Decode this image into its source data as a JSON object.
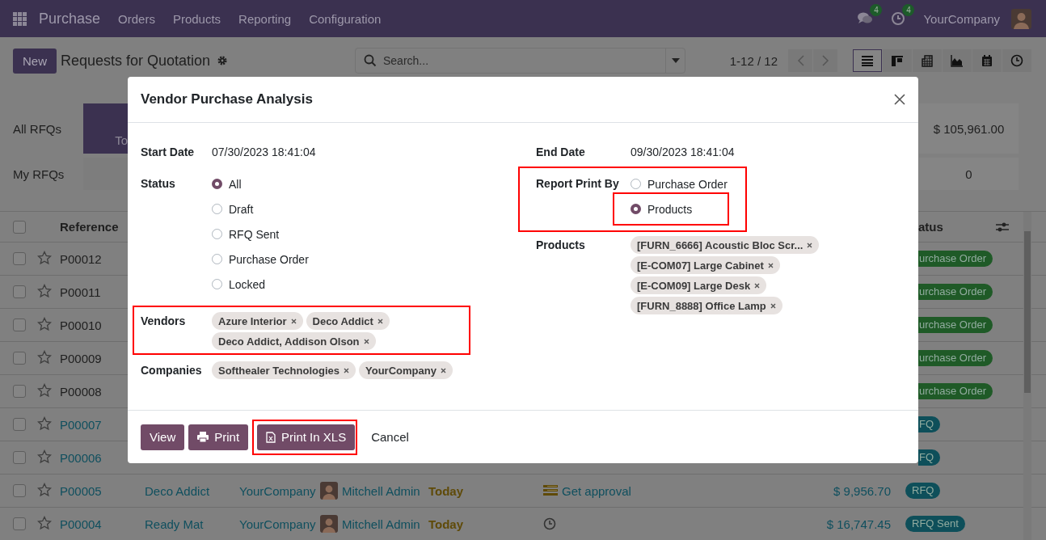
{
  "navbar": {
    "app_name": "Purchase",
    "menus": [
      "Orders",
      "Products",
      "Reporting",
      "Configuration"
    ],
    "messages_badge": "4",
    "activities_badge": "4",
    "company": "YourCompany"
  },
  "control_panel": {
    "new_button": "New",
    "title": "Requests for Quotation",
    "search": {
      "placeholder": "Search..."
    },
    "pager": "1-12 / 12",
    "views": [
      {
        "kind": "list",
        "selected": true
      },
      {
        "kind": "kanban",
        "selected": false
      },
      {
        "kind": "pivot",
        "selected": false
      },
      {
        "kind": "graph",
        "selected": false
      },
      {
        "kind": "calendar",
        "selected": false
      },
      {
        "kind": "activity",
        "selected": false
      }
    ]
  },
  "dashboard": {
    "row_labels": [
      "All RFQs",
      "My RFQs"
    ],
    "tile": "To",
    "totals": [
      "$ 105,961.00",
      "0"
    ]
  },
  "list": {
    "columns": [
      "Reference",
      "atus"
    ],
    "all_checked": false,
    "rows": [
      {
        "reference": "P00012",
        "checked": false,
        "link": false,
        "status": {
          "text": "urchase Order",
          "color": "#1f5a27"
        }
      },
      {
        "reference": "P00011",
        "checked": false,
        "link": false,
        "status": {
          "text": "urchase Order",
          "color": "#1f5a27"
        }
      },
      {
        "reference": "P00010",
        "checked": false,
        "link": false,
        "status": {
          "text": "urchase Order",
          "color": "#1f5a27"
        }
      },
      {
        "reference": "P00009",
        "checked": false,
        "link": false,
        "status": {
          "text": "urchase Order",
          "color": "#1f5a27"
        }
      },
      {
        "reference": "P00008",
        "checked": false,
        "link": false,
        "status": {
          "text": "urchase Order",
          "color": "#1f5a27"
        }
      },
      {
        "reference": "P00007",
        "checked": false,
        "link": true,
        "status": {
          "text": "FQ",
          "color": "#0e4f5a"
        }
      },
      {
        "reference": "P00006",
        "checked": false,
        "link": true,
        "status": {
          "text": "FQ",
          "color": "#0e4f5a"
        }
      },
      {
        "reference": "P00005",
        "checked": false,
        "link": true,
        "vendor": "Deco Addict",
        "company": "YourCompany",
        "buyer": "Mitchell Admin",
        "deadline": "Today",
        "activity": {
          "kind": "todo",
          "text": "Get approval"
        },
        "total": "$ 9,956.70",
        "status": {
          "text": "RFQ",
          "color": "#0e4f5a"
        }
      },
      {
        "reference": "P00004",
        "checked": false,
        "link": true,
        "vendor": "Ready Mat",
        "company": "YourCompany",
        "buyer": "Mitchell Admin",
        "deadline": "Today",
        "activity": {
          "kind": "clock"
        },
        "total": "$ 16,747.45",
        "status": {
          "text": "RFQ Sent",
          "color": "#0e4f5a"
        }
      }
    ]
  },
  "dialog": {
    "title": "Vendor Purchase Analysis",
    "left_fields": [
      {
        "kind": "text",
        "label": "Start Date",
        "value": "07/30/2023 18:41:04",
        "highlighted": false
      },
      {
        "kind": "radio",
        "label": "Status",
        "highlighted": false,
        "options": [
          {
            "label": "All",
            "selected": true,
            "highlighted": false
          },
          {
            "label": "Draft",
            "selected": false,
            "highlighted": false
          },
          {
            "label": "RFQ Sent",
            "selected": false,
            "highlighted": false
          },
          {
            "label": "Purchase Order",
            "selected": false,
            "highlighted": false
          },
          {
            "label": "Locked",
            "selected": false,
            "highlighted": false
          }
        ]
      },
      {
        "kind": "tags",
        "label": "Vendors",
        "highlighted": true,
        "tags": [
          "Azure Interior",
          "Deco Addict",
          "Deco Addict, Addison Olson"
        ]
      },
      {
        "kind": "tags",
        "label": "Companies",
        "highlighted": false,
        "tags": [
          "Softhealer Technologies",
          "YourCompany"
        ]
      }
    ],
    "right_fields": [
      {
        "kind": "text",
        "label": "End Date",
        "value": "09/30/2023 18:41:04",
        "highlighted": false
      },
      {
        "kind": "radio",
        "label": "Report Print By",
        "highlighted": true,
        "options": [
          {
            "label": "Purchase Order",
            "selected": false,
            "highlighted": false
          },
          {
            "label": "Products",
            "selected": true,
            "highlighted": true
          }
        ]
      },
      {
        "kind": "tags",
        "label": "Products",
        "highlighted": false,
        "tags": [
          "[FURN_6666] Acoustic Bloc Scr...",
          "[E-COM07] Large Cabinet",
          "[E-COM09] Large Desk",
          "[FURN_8888] Office Lamp"
        ]
      }
    ],
    "buttons": [
      {
        "kind": "primary",
        "label": "View",
        "highlighted": false
      },
      {
        "kind": "print",
        "label": "Print",
        "highlighted": false
      },
      {
        "kind": "xls",
        "label": "Print In XLS",
        "highlighted": true
      },
      {
        "kind": "link",
        "label": "Cancel",
        "highlighted": false
      }
    ]
  }
}
